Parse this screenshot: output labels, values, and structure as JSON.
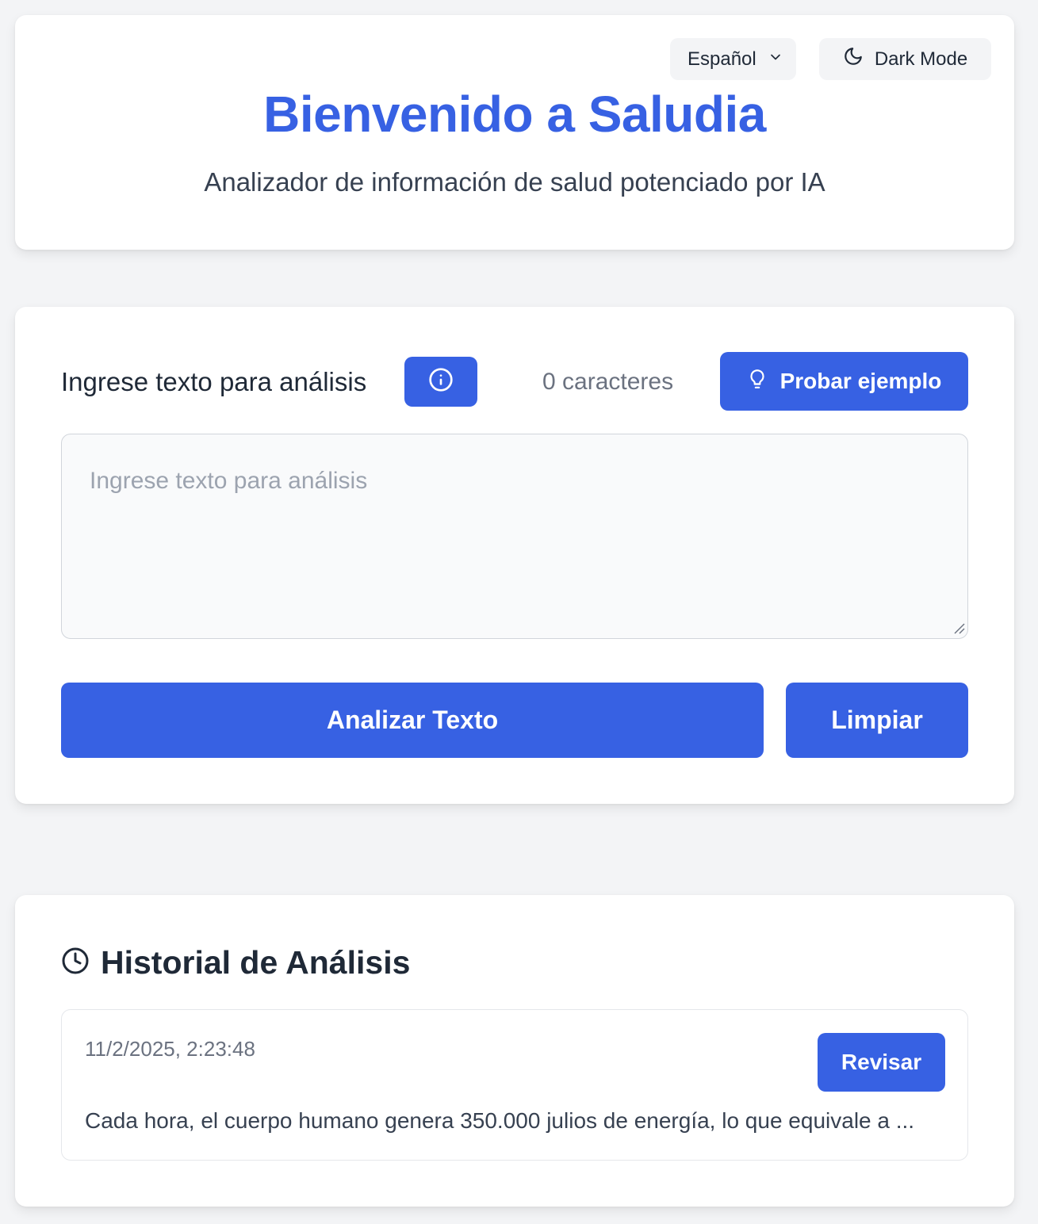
{
  "header": {
    "language_selected": "Español",
    "dark_mode_label": "Dark Mode",
    "title": "Bienvenido a Saludia",
    "subtitle": "Analizador de información de salud potenciado por IA"
  },
  "input": {
    "label": "Ingrese texto para análisis",
    "char_count": "0 caracteres",
    "example_button": "Probar ejemplo",
    "placeholder": "Ingrese texto para análisis",
    "value": "",
    "analyze_button": "Analizar Texto",
    "clear_button": "Limpiar"
  },
  "history": {
    "title": "Historial de Análisis",
    "entries": [
      {
        "timestamp": "11/2/2025, 2:23:48",
        "review_button": "Revisar",
        "text": "Cada hora, el cuerpo humano genera 350.000 julios de energía, lo que equivale a ..."
      }
    ]
  },
  "icons": {
    "language_chevron": "chevron-down-icon",
    "dark_mode": "moon-icon",
    "info": "info-icon",
    "example": "lightbulb-icon",
    "history": "clock-icon"
  },
  "colors": {
    "accent": "#3761e3",
    "background": "#f3f4f6",
    "card": "#ffffff"
  }
}
